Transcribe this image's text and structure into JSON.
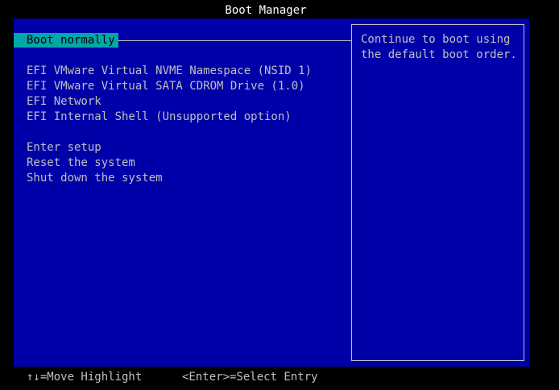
{
  "title": "Boot Manager",
  "menu": {
    "selected": "Boot normally",
    "devices": [
      "EFI VMware Virtual NVME Namespace (NSID 1)",
      "EFI VMware Virtual SATA CDROM Drive (1.0)",
      "EFI Network",
      "EFI Internal Shell (Unsupported option)"
    ],
    "actions": [
      "Enter setup",
      "Reset the system",
      "Shut down the system"
    ]
  },
  "help": {
    "text": "Continue to boot using\nthe default boot order."
  },
  "footer": {
    "move_hint": "↑↓=Move Highlight",
    "select_hint": "<Enter>=Select Entry"
  },
  "colors": {
    "background": "#0000A8",
    "highlight": "#00A8A8",
    "text": "#C0C0C0",
    "title": "#FFFFFF"
  }
}
